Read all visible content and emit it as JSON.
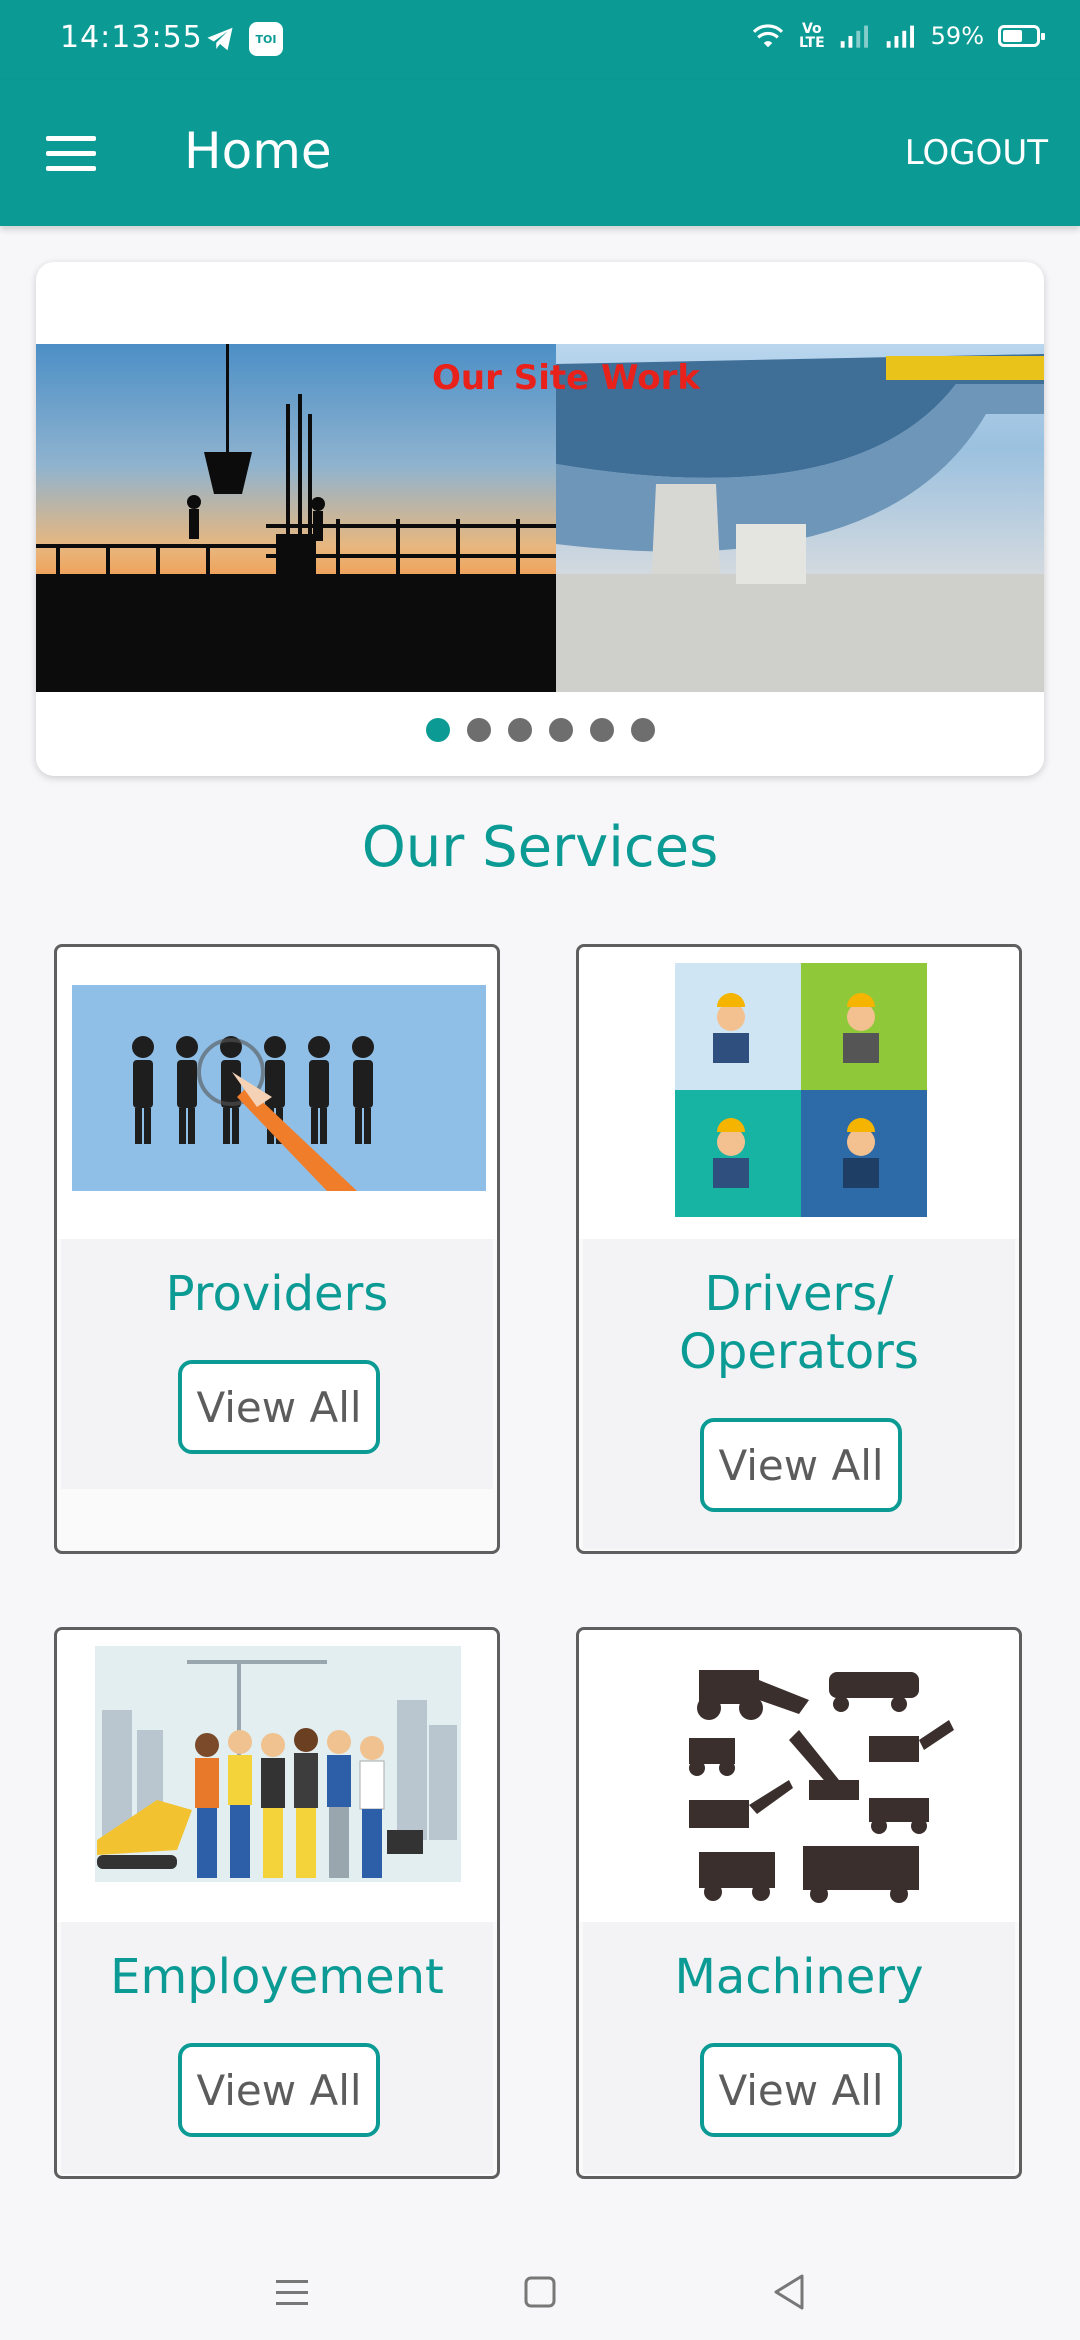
{
  "status_bar": {
    "time": "14:13:55",
    "toi_label": "TOI",
    "volte_top": "Vo",
    "volte_bottom": "LTE",
    "battery_percent": "59%",
    "battery_level": 0.59
  },
  "app_bar": {
    "title": "Home",
    "logout_label": "LOGOUT"
  },
  "carousel": {
    "caption": "Our Site Work",
    "slide_count": 6,
    "active_index": 0
  },
  "services": {
    "title": "Our Services",
    "cards": [
      {
        "label": "Providers",
        "button": "View All"
      },
      {
        "label_line1": "Drivers/",
        "label_line2": "Operators",
        "button": "View All"
      },
      {
        "label": "Employement",
        "button": "View All"
      },
      {
        "label": "Machinery",
        "button": "View All"
      }
    ]
  },
  "colors": {
    "primary": "#0b9b94",
    "caption_red": "#e8211b",
    "card_border": "#5f5f5f"
  },
  "icons": [
    "menu-icon",
    "wifi-icon",
    "signal-icon",
    "battery-icon",
    "telegram-icon",
    "recents-icon",
    "home-icon",
    "back-icon"
  ]
}
